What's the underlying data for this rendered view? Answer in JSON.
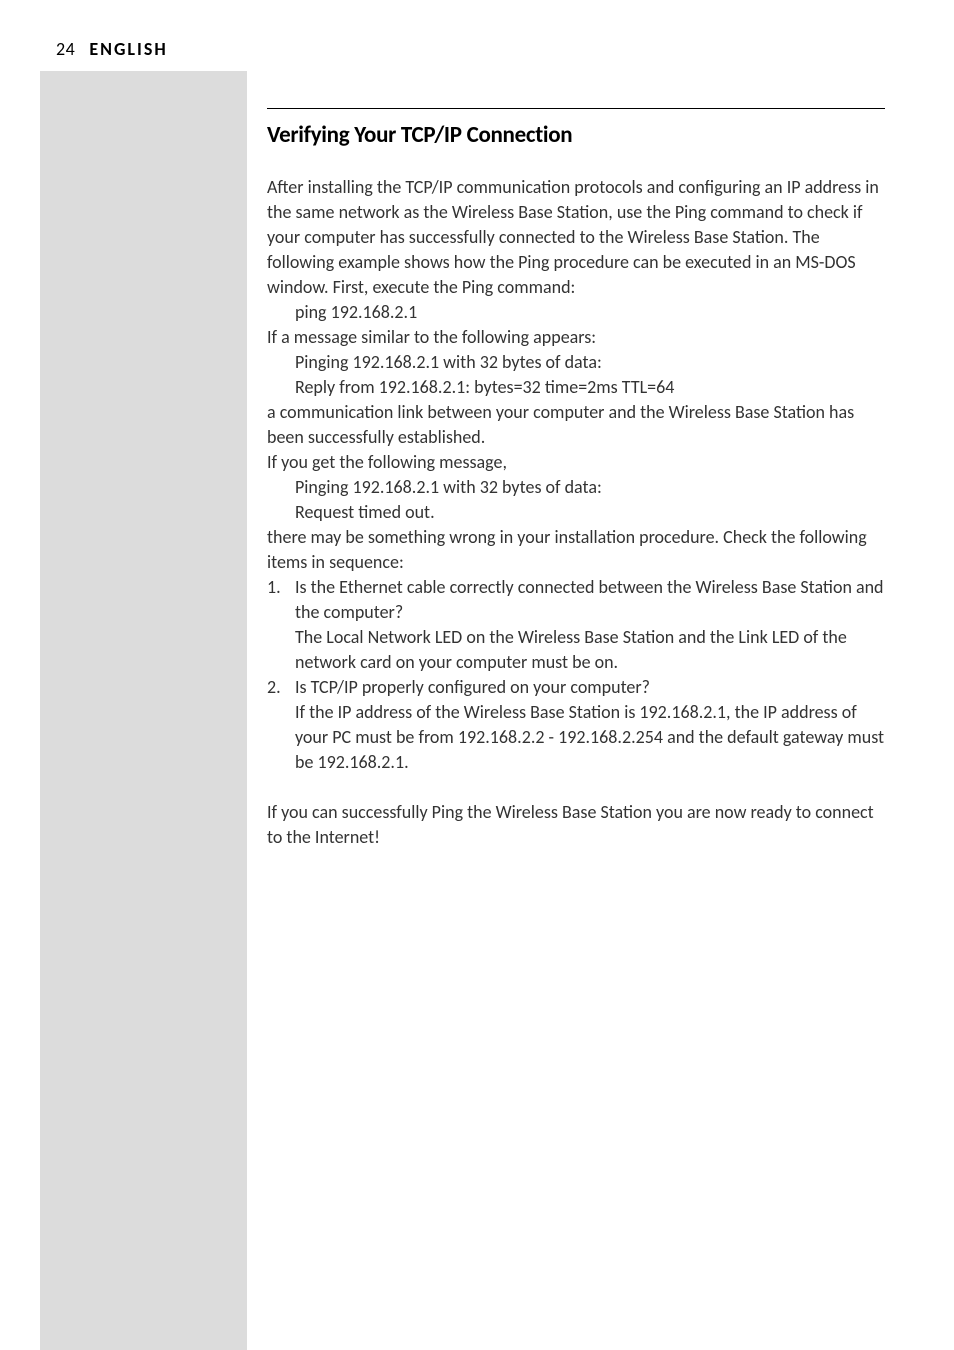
{
  "header": {
    "page_number": "24",
    "language": "ENGLISH"
  },
  "section": {
    "title": "Verifying Your TCP/IP Connection",
    "intro": "After installing the TCP/IP communication protocols and configuring an IP address in the same network as the Wireless Base Station, use the Ping command to check if your computer has successfully connected to the Wireless Base Station. The following example shows how the Ping procedure can be executed in an MS-DOS window. First, execute the Ping command:",
    "ping_cmd": "ping 192.168.2.1",
    "if_success": "If a message similar to the following appears:",
    "success_line1": "Pinging 192.168.2.1 with 32 bytes of data:",
    "success_line2": "Reply from 192.168.2.1: bytes=32 time=2ms TTL=64",
    "success_conclusion": "a communication link between your computer and the Wireless Base Station has been successfully established.",
    "if_failure": "If you get the following message,",
    "failure_line1": "Pinging 192.168.2.1 with 32 bytes of data:",
    "failure_line2": "Request timed out.",
    "failure_conclusion": "there may be something wrong in your installation procedure. Check the following items in sequence:",
    "item1_marker": "1.",
    "item1_q": "Is the Ethernet cable correctly connected between the Wireless Base Station and the computer?",
    "item1_a": "The Local Network LED on the Wireless Base Station and the Link LED of the network card on your computer must be on.",
    "item2_marker": "2.",
    "item2_q": "Is TCP/IP properly configured on your computer?",
    "item2_a": "If the IP address of the Wireless Base Station is 192.168.2.1, the IP address of your PC must be from 192.168.2.2 - 192.168.2.254 and the default gateway must be 192.168.2.1.",
    "closing": "If you can successfully Ping the Wireless Base Station you are now ready to connect to the Internet!"
  }
}
